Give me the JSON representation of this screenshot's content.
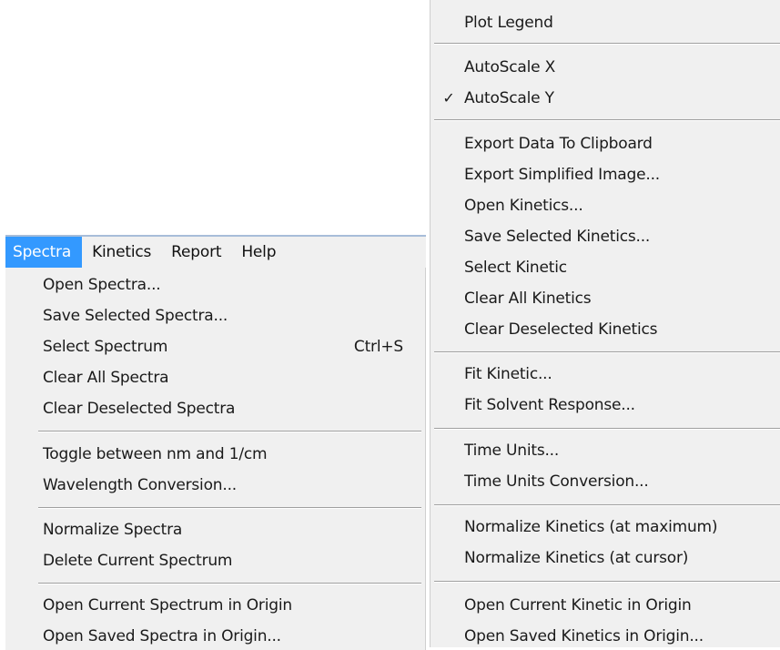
{
  "menubar": {
    "items": [
      "Spectra",
      "Kinetics",
      "Report",
      "Help"
    ]
  },
  "spectra_menu": {
    "items": [
      {
        "label": "Open Spectra..."
      },
      {
        "label": "Save Selected Spectra..."
      },
      {
        "label": "Select Spectrum",
        "shortcut": "Ctrl+S"
      },
      {
        "label": "Clear All Spectra"
      },
      {
        "label": "Clear Deselected Spectra"
      },
      {
        "label": "Toggle between nm and 1/cm"
      },
      {
        "label": "Wavelength Conversion..."
      },
      {
        "label": "Normalize Spectra"
      },
      {
        "label": "Delete Current Spectrum"
      },
      {
        "label": "Open Current Spectrum in Origin"
      },
      {
        "label": "Open Saved Spectra in Origin..."
      }
    ]
  },
  "kinetics_menu": {
    "items": [
      {
        "label": "Plot Legend"
      },
      {
        "label": "AutoScale X"
      },
      {
        "label": "AutoScale Y",
        "check": "✓"
      },
      {
        "label": "Export Data To Clipboard"
      },
      {
        "label": "Export Simplified Image..."
      },
      {
        "label": "Open Kinetics..."
      },
      {
        "label": "Save Selected Kinetics..."
      },
      {
        "label": "Select Kinetic"
      },
      {
        "label": "Clear All Kinetics"
      },
      {
        "label": "Clear Deselected Kinetics"
      },
      {
        "label": "Fit Kinetic..."
      },
      {
        "label": "Fit Solvent Response..."
      },
      {
        "label": "Time Units..."
      },
      {
        "label": "Time Units Conversion..."
      },
      {
        "label": "Normalize Kinetics (at maximum)"
      },
      {
        "label": "Normalize Kinetics (at cursor)"
      },
      {
        "label": "Open Current Kinetic in Origin"
      },
      {
        "label": "Open Saved Kinetics in Origin..."
      }
    ]
  },
  "colors": {
    "menu_background": "#f0f0f0",
    "highlight": "#3399ff",
    "separator": "#a0a0a0"
  }
}
